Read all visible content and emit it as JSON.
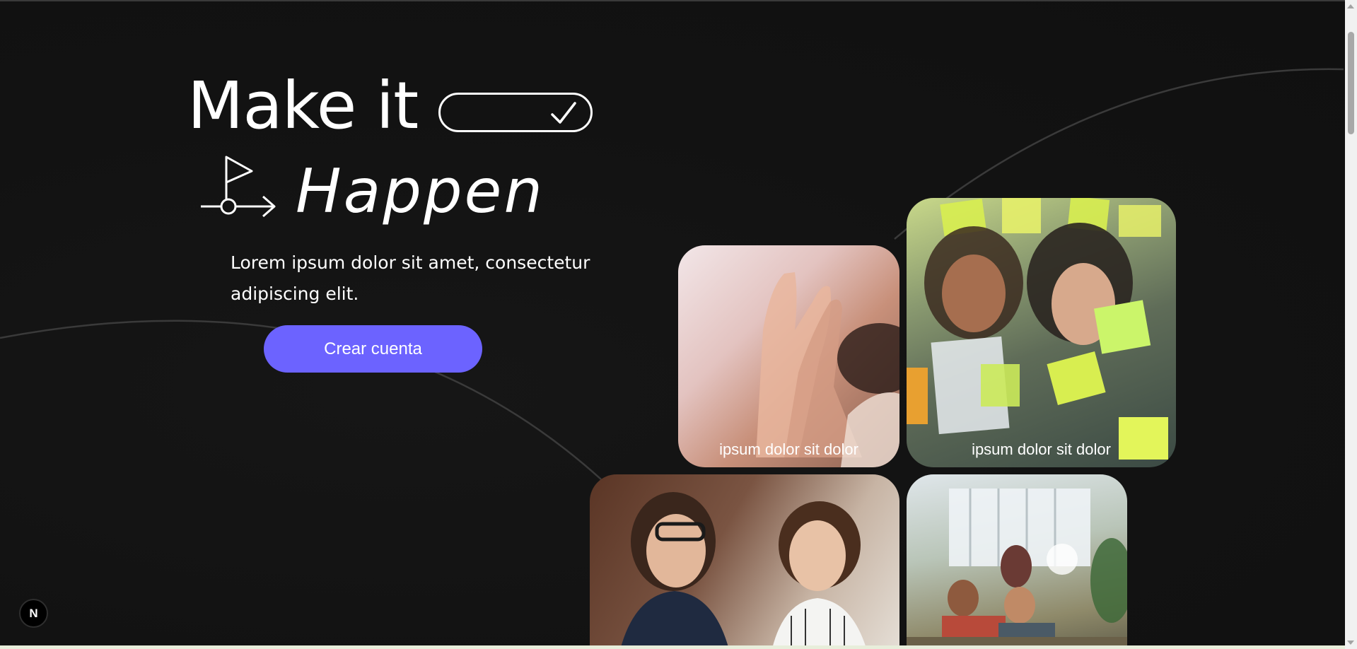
{
  "hero": {
    "title_line1": "Make it",
    "title_line2": "Happen",
    "subtitle": "Lorem ipsum dolor sit amet, consectetur adipiscing elit.",
    "cta_label": "Crear cuenta"
  },
  "cards": [
    {
      "caption": "ipsum dolor sit dolor",
      "icon": "high-five-photo"
    },
    {
      "caption": "ipsum dolor sit dolor",
      "icon": "sticky-notes-photo"
    },
    {
      "caption": "",
      "icon": "smiling-coworkers-photo"
    },
    {
      "caption": "",
      "icon": "office-team-photo"
    }
  ],
  "dev_badge": {
    "label": "N"
  },
  "colors": {
    "background": "#121212",
    "accent": "#6c63ff",
    "text": "#ffffff"
  }
}
